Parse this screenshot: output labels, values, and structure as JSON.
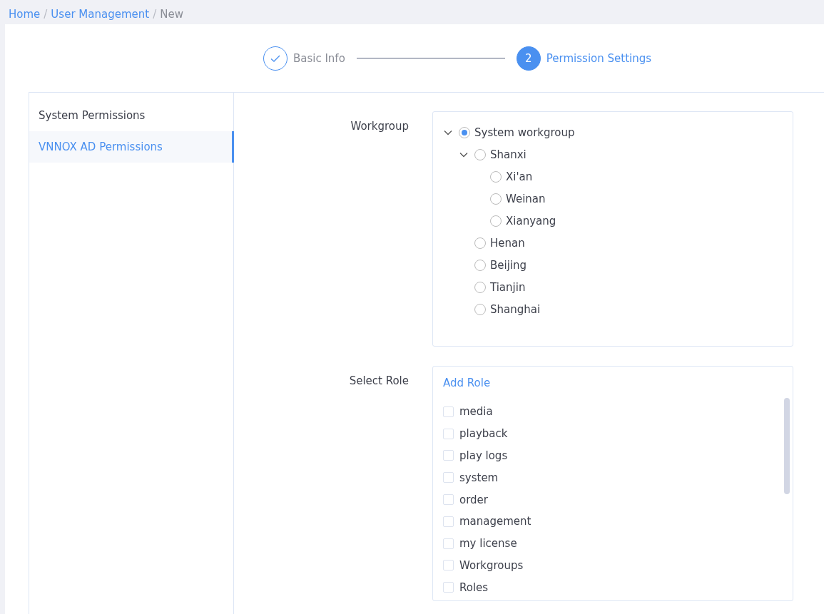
{
  "breadcrumb": [
    {
      "label": "Home",
      "current": false
    },
    {
      "label": "User Management",
      "current": false
    },
    {
      "label": "New",
      "current": true
    }
  ],
  "breadcrumb_separator": "/",
  "steps": [
    {
      "label": "Basic Info",
      "completed": true,
      "selected": false
    },
    {
      "marker": "2",
      "label": "Permission Settings",
      "completed": false,
      "selected": true
    }
  ],
  "sidebar": {
    "items": [
      {
        "label": "System Permissions",
        "selected": false
      },
      {
        "label": "VNNOX AD Permissions",
        "selected": true
      }
    ]
  },
  "workgroup": {
    "label": "Workgroup",
    "tree": [
      {
        "label": "System workgroup",
        "selected": true,
        "expanded": true,
        "children": [
          {
            "label": "Shanxi",
            "selected": false,
            "expanded": true,
            "children": [
              {
                "label": "Xi'an",
                "selected": false
              },
              {
                "label": "Weinan",
                "selected": false
              },
              {
                "label": "Xianyang",
                "selected": false
              }
            ]
          },
          {
            "label": "Henan",
            "selected": false
          },
          {
            "label": "Beijing",
            "selected": false
          },
          {
            "label": "Tianjin",
            "selected": false
          },
          {
            "label": "Shanghai",
            "selected": false
          }
        ]
      }
    ]
  },
  "roles": {
    "label": "Select Role",
    "add_link": "Add Role",
    "items": [
      {
        "label": "media",
        "checked": false
      },
      {
        "label": "playback",
        "checked": false
      },
      {
        "label": "play logs",
        "checked": false
      },
      {
        "label": "system",
        "checked": false
      },
      {
        "label": "order",
        "checked": false
      },
      {
        "label": "management",
        "checked": false
      },
      {
        "label": "my license",
        "checked": false
      },
      {
        "label": "Workgroups",
        "checked": false
      },
      {
        "label": "Roles",
        "checked": false
      }
    ]
  }
}
